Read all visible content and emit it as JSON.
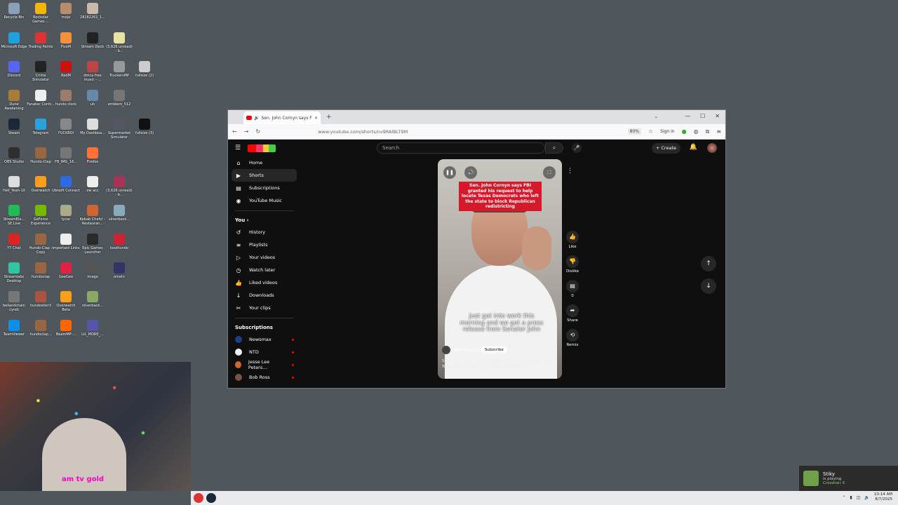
{
  "desktop": {
    "icons": [
      {
        "label": "Recycle Bin",
        "color": "#8aa0b8"
      },
      {
        "label": "Rockstar Games ...",
        "color": "#f2b705"
      },
      {
        "label": "mojo",
        "color": "#b78d6b"
      },
      {
        "label": "28162261_1...",
        "color": "#c9b9a9"
      },
      {
        "label": "Microsoft Edge",
        "color": "#1fa1e0"
      },
      {
        "label": "Trading Paints",
        "color": "#d33"
      },
      {
        "label": "FiveM",
        "color": "#f7903a"
      },
      {
        "label": "Stream Deck",
        "color": "#222"
      },
      {
        "label": "(3,626 unread) - b...",
        "color": "#e8e3a0"
      },
      {
        "label": "Discord",
        "color": "#5865f2"
      },
      {
        "label": "Crime Simulator",
        "color": "#222"
      },
      {
        "label": "RedM",
        "color": "#c11"
      },
      {
        "label": "dmca free music - ...",
        "color": "#b44"
      },
      {
        "label": "TruckersMP",
        "color": "#999"
      },
      {
        "label": "fullsize (2)",
        "color": "#ccc"
      },
      {
        "label": "Dune Awakening",
        "color": "#a87d3c"
      },
      {
        "label": "Fanatec Contr...",
        "color": "#eee"
      },
      {
        "label": "hundo clock",
        "color": "#9a7d6b"
      },
      {
        "label": "uh",
        "color": "#68a"
      },
      {
        "label": "emblem_512",
        "color": "#777"
      },
      {
        "label": "Steam",
        "color": "#1b2838"
      },
      {
        "label": "Telegram",
        "color": "#2aa1da"
      },
      {
        "label": "FUCKBOI",
        "color": "#888"
      },
      {
        "label": "My Dashboa...",
        "color": "#ddd"
      },
      {
        "label": "Supermarket Simulator",
        "color": "#556"
      },
      {
        "label": "fullsize (3)",
        "color": "#111"
      },
      {
        "label": "OBS Studio",
        "color": "#302e31"
      },
      {
        "label": "Hundo-Clap",
        "color": "#964"
      },
      {
        "label": "FB_IMG_16...",
        "color": "#777"
      },
      {
        "label": "Firefox",
        "color": "#ff7139"
      },
      {
        "label": "Hell_Yeah-10",
        "color": "#ddd"
      },
      {
        "label": "Overwatch",
        "color": "#f99e1a"
      },
      {
        "label": "Ubisoft Connect",
        "color": "#2d6be0"
      },
      {
        "label": "ow acc",
        "color": "#eee"
      },
      {
        "label": "(3,626 unread) - b...",
        "color": "#a35"
      },
      {
        "label": "StreamEle... SE.Live",
        "color": "#2b5"
      },
      {
        "label": "GeForce Experience",
        "color": "#76b900"
      },
      {
        "label": "tycar",
        "color": "#aa8"
      },
      {
        "label": "Kebab Chefs! - Restauran...",
        "color": "#c63"
      },
      {
        "label": "silverback...",
        "color": "#8ab"
      },
      {
        "label": "YT Chat",
        "color": "#d22"
      },
      {
        "label": "Hundo-Clap - Copy",
        "color": "#964"
      },
      {
        "label": "Important Links",
        "color": "#eee"
      },
      {
        "label": "Epic Games Launcher",
        "color": "#2a2a2a"
      },
      {
        "label": "koolhundo",
        "color": "#c23"
      },
      {
        "label": "Streamlabs Desktop",
        "color": "#31c3a2"
      },
      {
        "label": "hundoclap",
        "color": "#964"
      },
      {
        "label": "GeeGee",
        "color": "#d24"
      },
      {
        "label": "image",
        "color": "#555"
      },
      {
        "label": "ometv",
        "color": "#336"
      },
      {
        "label": "bellandchain cyndi",
        "color": "#777"
      },
      {
        "label": "hundostier3",
        "color": "#a54"
      },
      {
        "label": "Overwatch Beta",
        "color": "#f99e1a"
      },
      {
        "label": "silverback...",
        "color": "#8a6"
      },
      {
        "label": "TeamViewer",
        "color": "#0e8ee9"
      },
      {
        "label": "hundoclap...",
        "color": "#964"
      },
      {
        "label": "BeamMP-...",
        "color": "#f60"
      },
      {
        "label": "LIL_MORE_...",
        "color": "#55a"
      }
    ]
  },
  "webcam": {
    "shirt_text": "am tv gold"
  },
  "browser": {
    "tab_title": "Sen. John Cornyn says FBI g",
    "new_tab": "+",
    "url": "www.youtube.com/shorts/nv9RAlBLT9M",
    "zoom": "80%",
    "sign_in": "Sign in"
  },
  "youtube": {
    "search_placeholder": "Search",
    "create_label": "Create",
    "sidebar": {
      "main": [
        {
          "label": "Home",
          "icon": "home-icon",
          "glyph": "⌂"
        },
        {
          "label": "Shorts",
          "icon": "shorts-icon",
          "glyph": "▶"
        },
        {
          "label": "Subscriptions",
          "icon": "subscriptions-icon",
          "glyph": "▤"
        },
        {
          "label": "YouTube Music",
          "icon": "music-icon",
          "glyph": "◉"
        }
      ],
      "you_label": "You",
      "you": [
        {
          "label": "History",
          "icon": "history-icon",
          "glyph": "↺"
        },
        {
          "label": "Playlists",
          "icon": "playlists-icon",
          "glyph": "≡"
        },
        {
          "label": "Your videos",
          "icon": "your-videos-icon",
          "glyph": "▷"
        },
        {
          "label": "Watch later",
          "icon": "watch-later-icon",
          "glyph": "◷"
        },
        {
          "label": "Liked videos",
          "icon": "liked-icon",
          "glyph": "👍"
        },
        {
          "label": "Downloads",
          "icon": "downloads-icon",
          "glyph": "↓"
        },
        {
          "label": "Your clips",
          "icon": "clips-icon",
          "glyph": "✂"
        }
      ],
      "subscriptions_label": "Subscriptions",
      "subscriptions": [
        {
          "label": "Newsmax",
          "color": "#1c3f8a"
        },
        {
          "label": "NTD",
          "color": "#eee"
        },
        {
          "label": "Jesse Lee Peters...",
          "color": "#c63"
        },
        {
          "label": "Bob Ross",
          "color": "#754"
        }
      ]
    },
    "short": {
      "red_caption": "Sen. John Cornyn says FBI granted his request to help locate Texas Democrats who left the state to block Republican redistricting",
      "overlay_text": "Just got into work this morning and we got a press release from Senator John",
      "channel": "@willbmoore",
      "subscribe": "Subscribe",
      "description": "Sen. John Cornyn says FBI granted request to help locate Texas Democrats blocking GOP redistricting"
    },
    "actions": {
      "like": "Like",
      "dislike": "Dislike",
      "comments": "0",
      "share": "Share",
      "remix": "Remix"
    }
  },
  "taskbar": {
    "time": "10:14 AM",
    "date": "8/7/2025"
  },
  "toast": {
    "name": "Stiky",
    "status": "is playing",
    "game": "Crosshair X"
  }
}
